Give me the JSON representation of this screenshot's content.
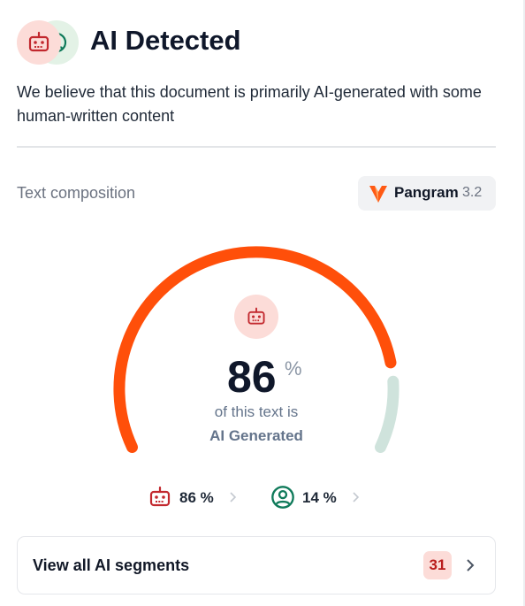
{
  "header": {
    "title": "AI Detected",
    "description": "We believe that this document is primarily AI-generated with some human-written content"
  },
  "composition": {
    "label": "Text composition",
    "brand_name": "Pangram",
    "brand_version": "3.2"
  },
  "gauge": {
    "value": "86",
    "unit": "%",
    "caption_line1": "of this text is",
    "caption_line2": "AI Generated",
    "ai_fraction": 0.86,
    "human_fraction": 0.14
  },
  "stats": {
    "ai_label": "86 %",
    "human_label": "14 %"
  },
  "segments": {
    "label": "View all AI segments",
    "count": "31"
  },
  "colors": {
    "ai": "#ff4f0a",
    "human": "#cfe3dc",
    "ai_icon": "#c2282e",
    "human_icon": "#0f7a5a"
  }
}
